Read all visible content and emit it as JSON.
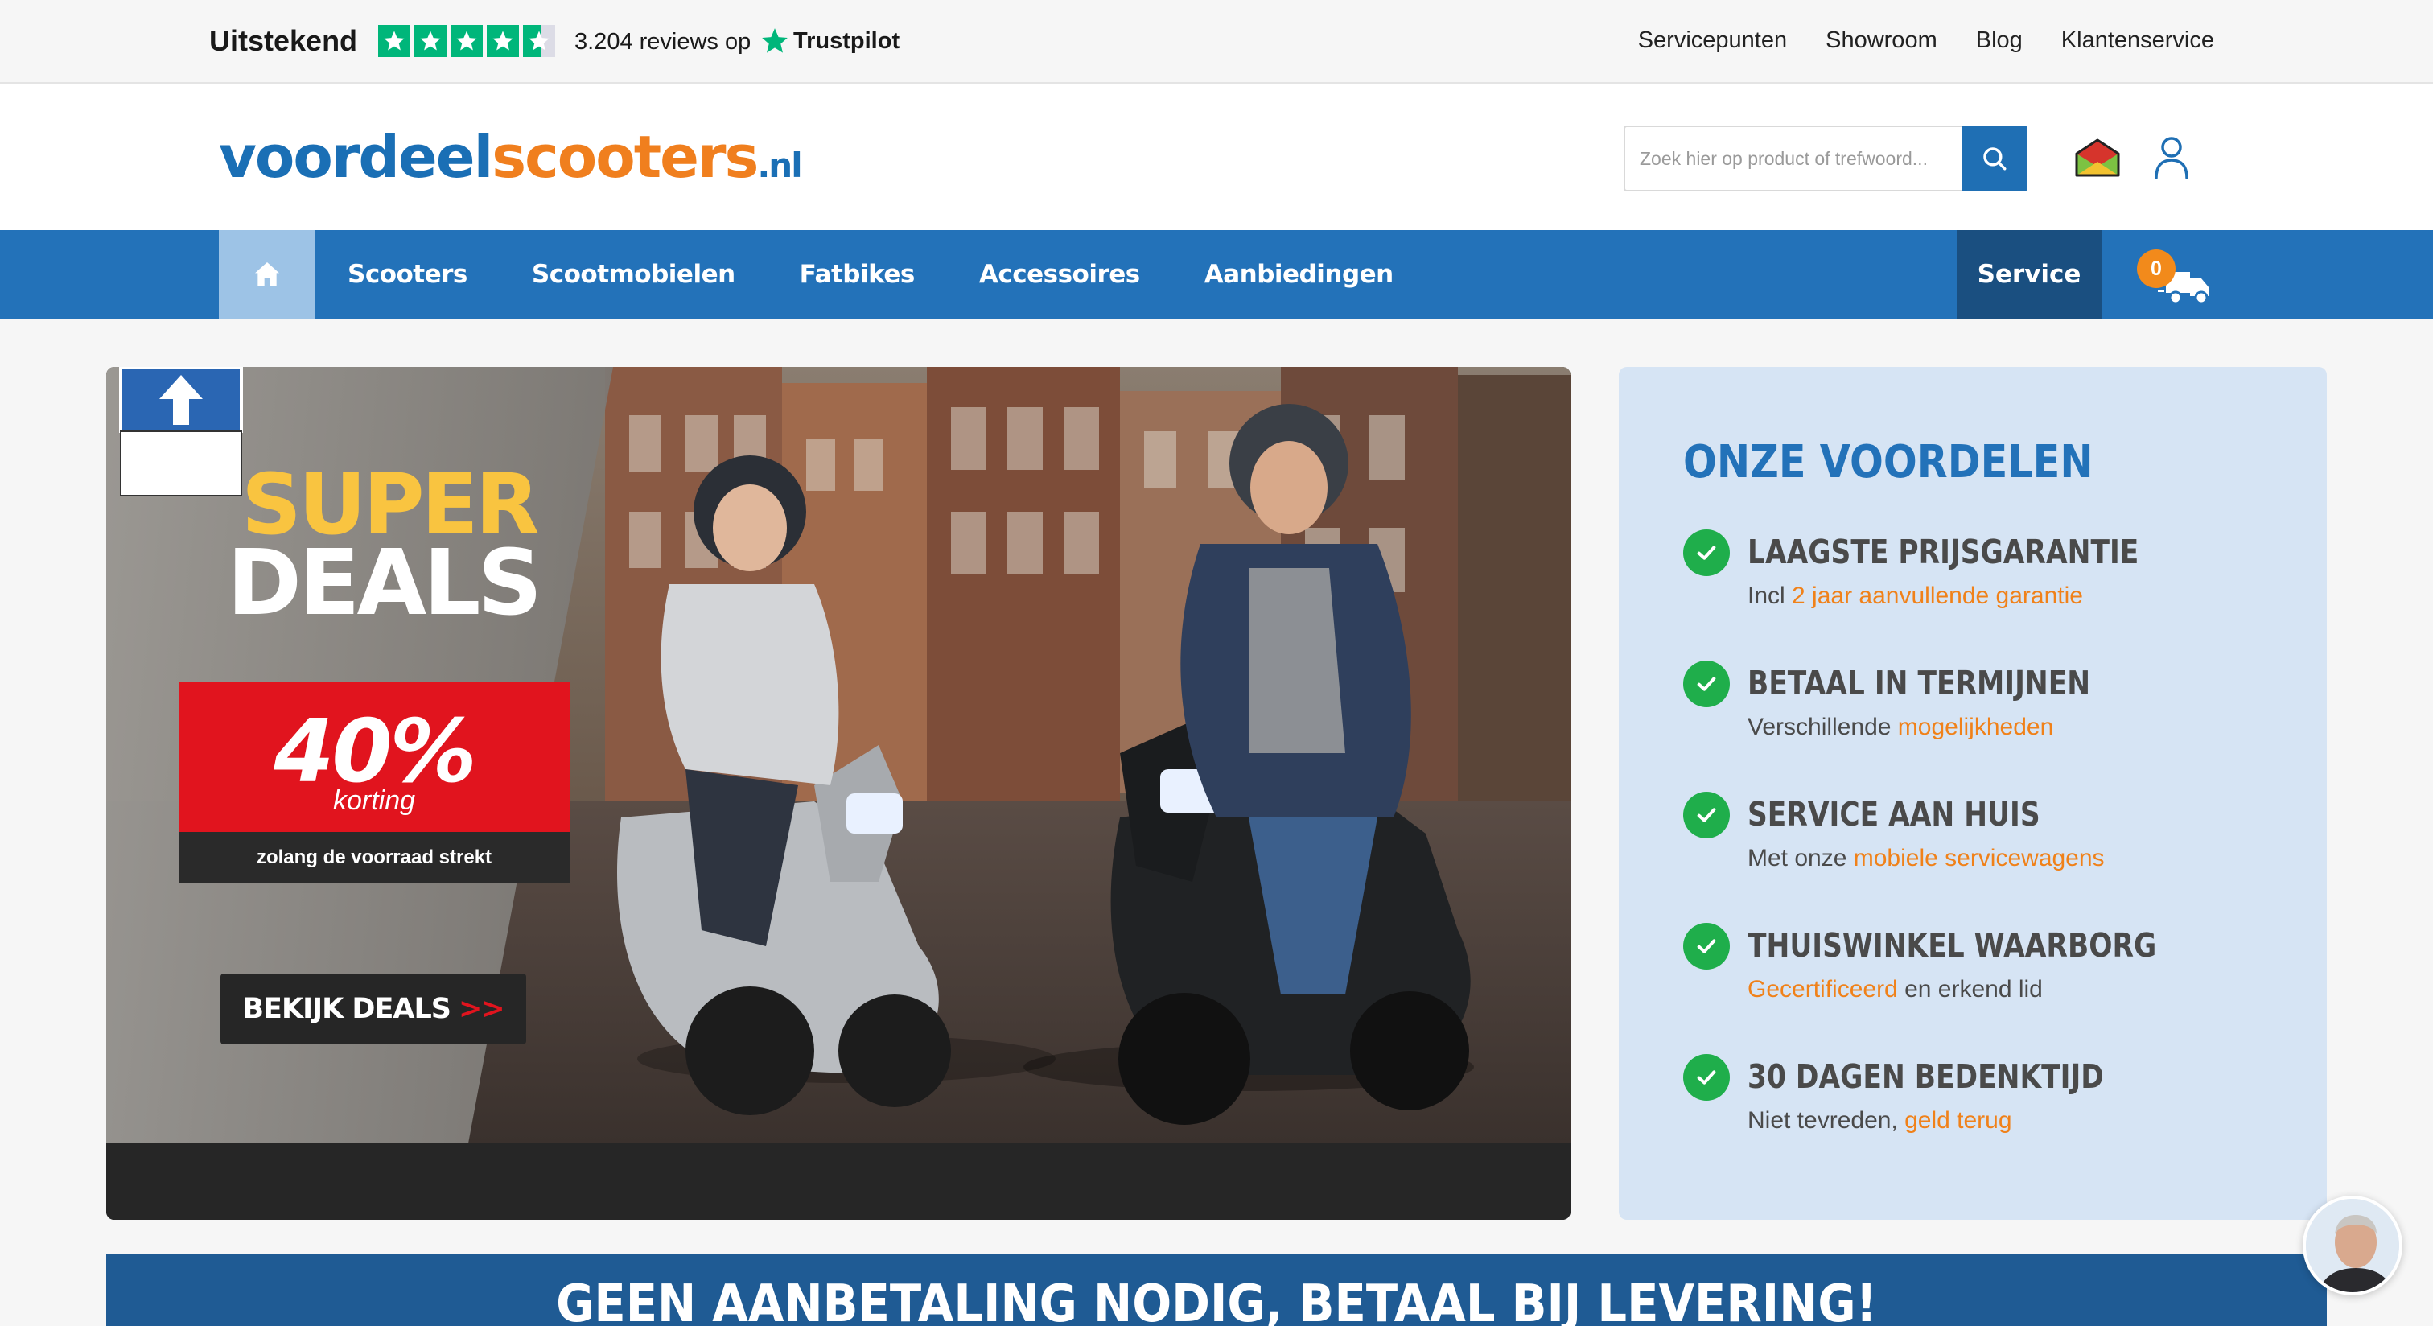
{
  "topbar": {
    "rating_label": "Uitstekend",
    "review_count_text": "3.204 reviews op",
    "trustpilot_label": "Trustpilot",
    "stars": 4.5,
    "links": [
      "Servicepunten",
      "Showroom",
      "Blog",
      "Klantenservice"
    ]
  },
  "header": {
    "logo": {
      "part1": "voordeel",
      "part2": "scooters",
      "part3": ".nl"
    },
    "search_placeholder": "Zoek hier op product of trefwoord..."
  },
  "nav": {
    "items": [
      "Scooters",
      "Scootmobielen",
      "Fatbikes",
      "Accessoires",
      "Aanbiedingen"
    ],
    "service_label": "Service",
    "cart_count": "0"
  },
  "hero": {
    "line1": "SUPER",
    "line2": "DEALS",
    "percent": "40%",
    "korting": "korting",
    "subtext": "zolang de voorraad strekt",
    "cta_label": "BEKIJK DEALS",
    "cta_arrows": ">>"
  },
  "benefits": {
    "title": "ONZE VOORDELEN",
    "items": [
      {
        "heading": "LAAGSTE PRIJSGARANTIE",
        "pre": "Incl ",
        "highlight": "2 jaar aanvullende garantie",
        "post": ""
      },
      {
        "heading": "BETAAL IN TERMIJNEN",
        "pre": "Verschillende ",
        "highlight": "mogelijkheden",
        "post": ""
      },
      {
        "heading": "SERVICE AAN HUIS",
        "pre": "Met onze ",
        "highlight": "mobiele servicewagens",
        "post": ""
      },
      {
        "heading": "THUISWINKEL WAARBORG",
        "pre": "",
        "highlight": "Gecertificeerd",
        "post": " en erkend lid"
      },
      {
        "heading": "30 DAGEN BEDENKTIJD",
        "pre": "Niet tevreden, ",
        "highlight": "geld terug",
        "post": ""
      }
    ]
  },
  "banner": {
    "text": "GEEN AANBETALING NODIG, BETAAL BIJ LEVERING!"
  },
  "colors": {
    "brand_blue": "#2372b9",
    "accent_orange": "#f08119",
    "trustpilot_green": "#00b67a",
    "check_green": "#1fae4b",
    "deal_red": "#e1141e"
  }
}
